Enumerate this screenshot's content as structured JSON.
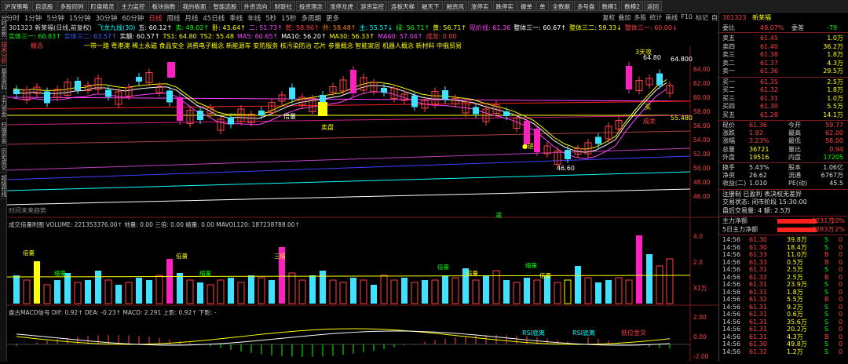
{
  "toolbar": [
    "沪深策略",
    "自选股",
    "多股同列",
    "盯盘精灵",
    "主力监控",
    "板块指数",
    "我的板面",
    "智能选股",
    "外资流向",
    "财联社",
    "投资理念",
    "涨停龙虎",
    "游资监控",
    "连板天梯",
    "融天下",
    "融资风",
    "涨停实",
    "跌停实",
    "撤单",
    "单",
    "全数据",
    "多号盘",
    "数模1",
    "数模2",
    "返回"
  ],
  "periods": [
    "分时",
    "1分钟",
    "5分钟",
    "15分钟",
    "30分钟",
    "60分钟",
    "日线",
    "周线",
    "月线",
    "45日线",
    "季线",
    "年线",
    "5秒",
    "15秒",
    "多周期",
    "更多"
  ],
  "active_period": "日线",
  "right_links": [
    "复权",
    "叠加",
    "多股",
    "统计",
    "画线",
    "F10",
    "标记",
    "自选",
    "返回"
  ],
  "left_nav": [
    "分时走势",
    "技术分析",
    "基本资料",
    "主力资金",
    "扫描资金",
    "历史成交",
    "超级短线"
  ],
  "main": {
    "title": "301323 新莱福(日线,前复权)",
    "sub_indicators": [
      {
        "t": "飞龙九线(30)",
        "c": "#00ffff"
      },
      {
        "t": "五: 60.12↑",
        "c": "#ffffff"
      },
      {
        "t": "卖: 49.02↑",
        "c": "#00ff00"
      },
      {
        "t": "卧: 43.64↑",
        "c": "#ffff00"
      },
      {
        "t": "二: 51.73↑",
        "c": "#ff40ff"
      },
      {
        "t": "乾: 58.96↑",
        "c": "#ff4040"
      },
      {
        "t": "共: 58.48↑",
        "c": "#ff8000"
      },
      {
        "t": "主: 55.57↓",
        "c": "#00ffff"
      },
      {
        "t": "绿: 56.71↑",
        "c": "#00ff00"
      },
      {
        "t": "黄: 56.71↑",
        "c": "#ffff00"
      },
      {
        "t": "现价线: 61.36",
        "c": "#ff40ff"
      },
      {
        "t": "整体三一: 60.67↑",
        "c": "#ffffff"
      },
      {
        "t": "整体三二: 59.33↓",
        "c": "#ffff00"
      },
      {
        "t": "整体三一: 60.00↓",
        "c": "#ff4040"
      }
    ],
    "ma_row": [
      {
        "t": "实体三一: 60.83↑",
        "c": "#00ff00"
      },
      {
        "t": "实体三二: 63.57↑",
        "c": "#4060ff"
      },
      {
        "t": "实额: 60.57↑",
        "c": "#ffffff"
      },
      {
        "t": "TS1: 64.80",
        "c": "#ffff00"
      },
      {
        "t": "TS2: 55.48",
        "c": "#ffff00"
      },
      {
        "t": "MA5: 60.65↑",
        "c": "#ff40ff"
      },
      {
        "t": "MA10: 56.20↑",
        "c": "#ffffff"
      },
      {
        "t": "MA30: 56.33↑",
        "c": "#ffff00"
      },
      {
        "t": "MA60: 57.04↑",
        "c": "#ff40ff"
      },
      {
        "t": "成龙: 0.00",
        "c": "#ff4040"
      }
    ],
    "concept_label": "概念",
    "concepts": "一带一路 粤港澳 稀土永磁 食品安全 消费电子概念 新能源车 安防服务 核污染防治 芯片 参量概念 智能家居 机器人概念 新材料 中俄贸易",
    "labels": {
      "sell_mark": "卖盘",
      "sell_a": "卖",
      "bear": "倍量",
      "hi_label": "64.80",
      "hi2": "64.800",
      "ts2": "55.480",
      "lo": "46.60",
      "jin": "●进",
      "buy": "买",
      "sanlong": "3天攻",
      "chenglong": "成龙",
      "future": "时间未来趋势",
      "watch": "减"
    },
    "scale": [
      "64.00",
      "62.00",
      "60.00",
      "58.00",
      "56.00",
      "54.00",
      "52.00",
      "50.00",
      "48.00",
      "46.00"
    ]
  },
  "volume": {
    "title": "成交倍量附图 VOLUME: 221353376.00↑ 地量: 0.00 三倍: 0.00 缩量: 0.00 MAVOL120: 187238788.00↑",
    "bars": [
      1.2,
      1.0,
      1.8,
      0.8,
      1.0,
      1.3,
      0.9,
      1.0,
      1.4,
      1.0,
      0.8,
      0.9,
      1.1,
      1.0,
      1.2,
      1.9,
      1.3,
      1.0,
      0.9,
      0.8,
      1.0,
      1.1,
      0.9,
      1.2,
      1.1,
      1.0,
      2.4,
      1.3,
      1.0,
      1.2,
      1.4,
      1.0,
      0.9,
      1.1,
      1.0,
      0.8,
      1.2,
      1.0,
      1.1,
      0.9,
      1.0,
      1.0,
      1.2,
      1.1,
      1.5,
      1.0,
      1.2,
      1.4,
      1.0,
      0.9,
      1.1,
      1.0,
      1.2,
      0.9,
      1.0,
      1.6,
      1.1,
      0.9,
      1.0,
      1.1,
      1.0,
      2.9,
      2.1,
      1.6,
      1.9
    ],
    "up": [
      0,
      1,
      0,
      1,
      0,
      0,
      1,
      0,
      0,
      1,
      0,
      1,
      0,
      0,
      1,
      0,
      0,
      1,
      0,
      1,
      1,
      0,
      1,
      0,
      1,
      0,
      0,
      1,
      1,
      0,
      0,
      1,
      1,
      0,
      1,
      0,
      1,
      1,
      0,
      1,
      0,
      1,
      0,
      1,
      0,
      1,
      0,
      1,
      0,
      1,
      0,
      1,
      0,
      1,
      1,
      0,
      1,
      0,
      0,
      1,
      1,
      1,
      0,
      1,
      1
    ],
    "tags": [
      "倍量",
      "缩量",
      "倍量",
      "缩量",
      "三倍",
      "倍量",
      "倍量",
      "缩量",
      "倍量"
    ],
    "scale": [
      "4.0",
      "2.0",
      "X1万"
    ]
  },
  "macd": {
    "title": "盘古MACD信号 DIF: 0.92↑ DEA: -0.23↑ MACD: 2.291 上影: 0.92↑ 下影: -",
    "labels": [
      "RSI底离",
      "RSI底离",
      "低位金叉"
    ],
    "scale": [
      "2.00",
      "0.00",
      "-2.00"
    ]
  },
  "quote": {
    "code": "301323",
    "name": "新莱福",
    "weibi": "委比",
    "weibi_v": "49.07%",
    "weicha": "委差",
    "weicha_v": "-79",
    "sell": [
      [
        "卖五",
        "61.45",
        "1.0万"
      ],
      [
        "卖四",
        "61.40",
        "36.2万"
      ],
      [
        "卖三",
        "61.38",
        "1.8万"
      ],
      [
        "卖二",
        "61.37",
        "4.3万"
      ],
      [
        "卖一",
        "61.36",
        "29.5万"
      ]
    ],
    "buy": [
      [
        "买一",
        "61.35",
        "2.5万"
      ],
      [
        "买二",
        "61.32",
        "1.8万"
      ],
      [
        "买三",
        "61.31",
        "1.0万"
      ],
      [
        "买四",
        "61.30",
        "5.5万"
      ],
      [
        "买五",
        "61.28",
        "14.1万"
      ]
    ],
    "stats": [
      [
        "现价",
        "61.36",
        "今开",
        "59.77"
      ],
      [
        "涨跌",
        "1.92",
        "最高",
        "62.00"
      ],
      [
        "涨幅",
        "3.23%",
        "最低",
        "58.00"
      ],
      [
        "总量",
        "36721",
        "量比",
        "0.94"
      ],
      [
        "外盘",
        "19516",
        "内盘",
        "17205"
      ],
      [
        "换手",
        "5.43%",
        "股本",
        "1.06亿"
      ],
      [
        "净资",
        "26.62",
        "流通",
        "6767万"
      ],
      [
        "收益(二)",
        "1.010",
        "PE(动)",
        "45.5"
      ]
    ],
    "trade_state": "注册制 已盈利 表决权无差异",
    "trade_time": "交易状态: 闭市阶段 15:30:00",
    "big_orders": "盘后交易量: 4 额: 2.5万",
    "flow": [
      [
        "主力净额",
        "2231万",
        "10%"
      ],
      [
        "5日主力净额",
        "2283万",
        "2%"
      ]
    ],
    "ticks": [
      [
        "14:56",
        "61.30",
        "39.8万",
        "S",
        "0"
      ],
      [
        "14:56",
        "61.30",
        "18.4万",
        "S",
        "0"
      ],
      [
        "14:56",
        "61.33",
        "11.0万",
        "B",
        "0"
      ],
      [
        "14:56",
        "61.33",
        "0.5万",
        "B",
        "0"
      ],
      [
        "14:56",
        "61.31",
        "2.5万",
        "S",
        "0"
      ],
      [
        "14:56",
        "61.32",
        "2.5万",
        "B",
        "0"
      ],
      [
        "14:56",
        "61.31",
        "23.9万",
        "S",
        "0"
      ],
      [
        "14:56",
        "61.31",
        "1.8万",
        "S",
        "0"
      ],
      [
        "14:56",
        "61.32",
        "5.5万",
        "B",
        "0"
      ],
      [
        "14:56",
        "61.31",
        "9.2万",
        "S",
        "0"
      ],
      [
        "14:56",
        "61.31",
        "0.6万",
        "S",
        "0"
      ],
      [
        "14:56",
        "61.31",
        "35.6万",
        "S",
        "0"
      ],
      [
        "14:56",
        "61.31",
        "20.2万",
        "S",
        "0"
      ],
      [
        "14:56",
        "61.31",
        "4.3万",
        "B",
        "0"
      ],
      [
        "14:56",
        "61.30",
        "49.8万",
        "S",
        "0"
      ],
      [
        "14:56",
        "61.32",
        "1.2万",
        "S",
        "0"
      ],
      [
        "14:56",
        "61.31",
        "15.3万",
        "S",
        "0"
      ]
    ]
  }
}
